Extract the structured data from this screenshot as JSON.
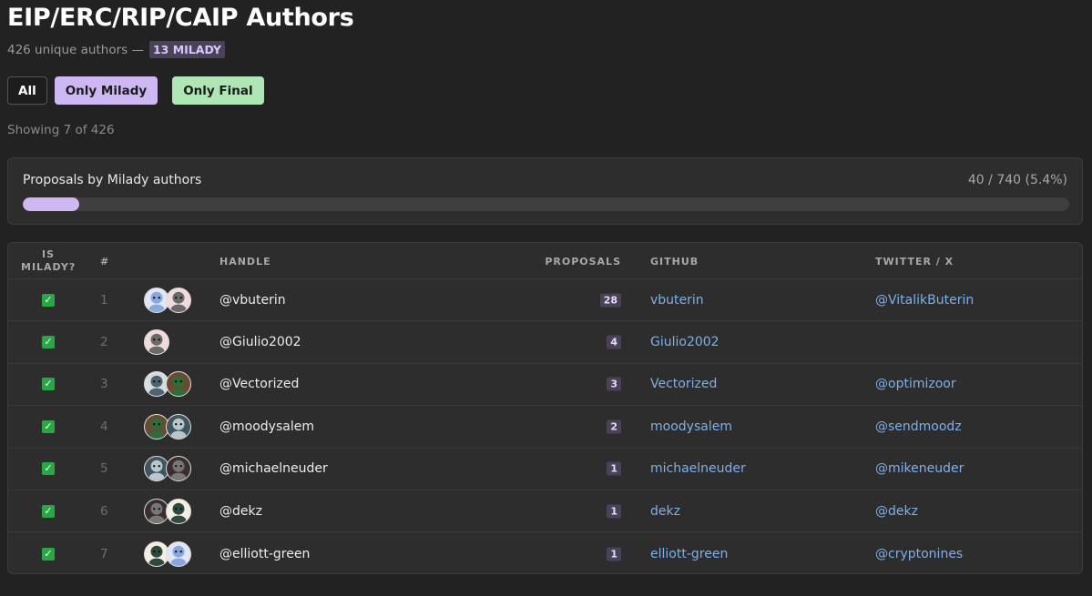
{
  "header": {
    "title": "EIP/ERC/RIP/CAIP Authors",
    "subtitle_prefix": "426 unique authors —",
    "milady_badge": "13 MILADY"
  },
  "filters": {
    "all": "All",
    "only_milady": "Only Milady",
    "only_final": "Only Final"
  },
  "showing": "Showing 7 of 426",
  "progress": {
    "label": "Proposals by Milady authors",
    "value_text": "40 / 740 (5.4%)",
    "fraction": 0.054
  },
  "table": {
    "columns": {
      "is_milady": "IS MILADY?",
      "num": "#",
      "handle": "HANDLE",
      "proposals": "PROPOSALS",
      "github": "GITHUB",
      "twitter": "TWITTER / X"
    },
    "rows": [
      {
        "num": "1",
        "handle": "@vbuterin",
        "proposals": "28",
        "github": "vbuterin",
        "twitter": "@VitalikButerin",
        "avatars": 2,
        "check": "✓"
      },
      {
        "num": "2",
        "handle": "@Giulio2002",
        "proposals": "4",
        "github": "Giulio2002",
        "twitter": "",
        "avatars": 1,
        "check": "✓"
      },
      {
        "num": "3",
        "handle": "@Vectorized",
        "proposals": "3",
        "github": "Vectorized",
        "twitter": "@optimizoor",
        "avatars": 2,
        "check": "✓"
      },
      {
        "num": "4",
        "handle": "@moodysalem",
        "proposals": "2",
        "github": "moodysalem",
        "twitter": "@sendmoodz",
        "avatars": 2,
        "check": "✓"
      },
      {
        "num": "5",
        "handle": "@michaelneuder",
        "proposals": "1",
        "github": "michaelneuder",
        "twitter": "@mikeneuder",
        "avatars": 2,
        "check": "✓"
      },
      {
        "num": "6",
        "handle": "@dekz",
        "proposals": "1",
        "github": "dekz",
        "twitter": "@dekz",
        "avatars": 2,
        "check": "✓"
      },
      {
        "num": "7",
        "handle": "@elliott-green",
        "proposals": "1",
        "github": "elliott-green",
        "twitter": "@cryptonines",
        "avatars": 2,
        "check": "✓"
      }
    ]
  },
  "colors": {
    "accent_milady": "#cdb8f4",
    "accent_final": "#aee6b6",
    "link": "#7fb0e6",
    "check_green": "#27a844"
  }
}
